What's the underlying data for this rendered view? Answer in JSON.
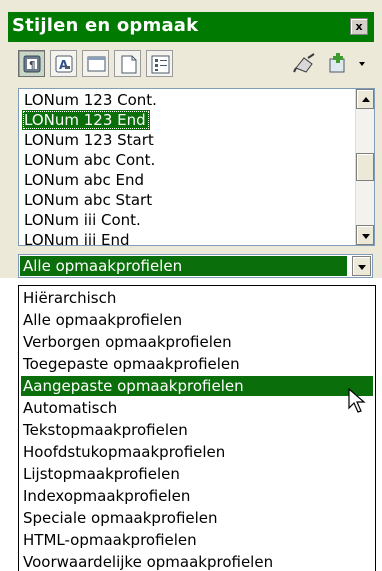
{
  "window": {
    "title": "Stijlen en opmaak",
    "close_label": "x"
  },
  "toolbar": {
    "buttons": [
      {
        "icon": "paragraph-styles-icon",
        "active": true
      },
      {
        "icon": "character-styles-icon",
        "active": false
      },
      {
        "icon": "frame-styles-icon",
        "active": false
      },
      {
        "icon": "page-styles-icon",
        "active": false
      },
      {
        "icon": "list-styles-icon",
        "active": false
      }
    ],
    "fill_format_icon": "fill-format-mode-icon",
    "new_style_icon": "new-style-from-selection-icon"
  },
  "style_list": {
    "items": [
      "LONum 123 Cont.",
      "LONum 123 End",
      "LONum 123 Start",
      "LONum abc Cont.",
      "LONum abc End",
      "LONum abc Start",
      "LONum iii Cont.",
      "LONum iii End"
    ],
    "selected": "LONum 123 End"
  },
  "filter": {
    "value": "Alle opmaakprofielen",
    "options": [
      "Hiërarchisch",
      "Alle opmaakprofielen",
      "Verborgen opmaakprofielen",
      "Toegepaste opmaakprofielen",
      "Aangepaste opmaakprofielen",
      "Automatisch",
      "Tekstopmaakprofielen",
      "Hoofdstukopmaakprofielen",
      "Lijstopmaakprofielen",
      "Indexopmaakprofielen",
      "Speciale opmaakprofielen",
      "HTML-opmaakprofielen",
      "Voorwaardelijke opmaakprofielen"
    ],
    "highlighted": "Aangepaste opmaakprofielen"
  },
  "colors": {
    "accent": "#007a00",
    "selection": "#0a6e0a",
    "panel": "#ece9d8"
  }
}
